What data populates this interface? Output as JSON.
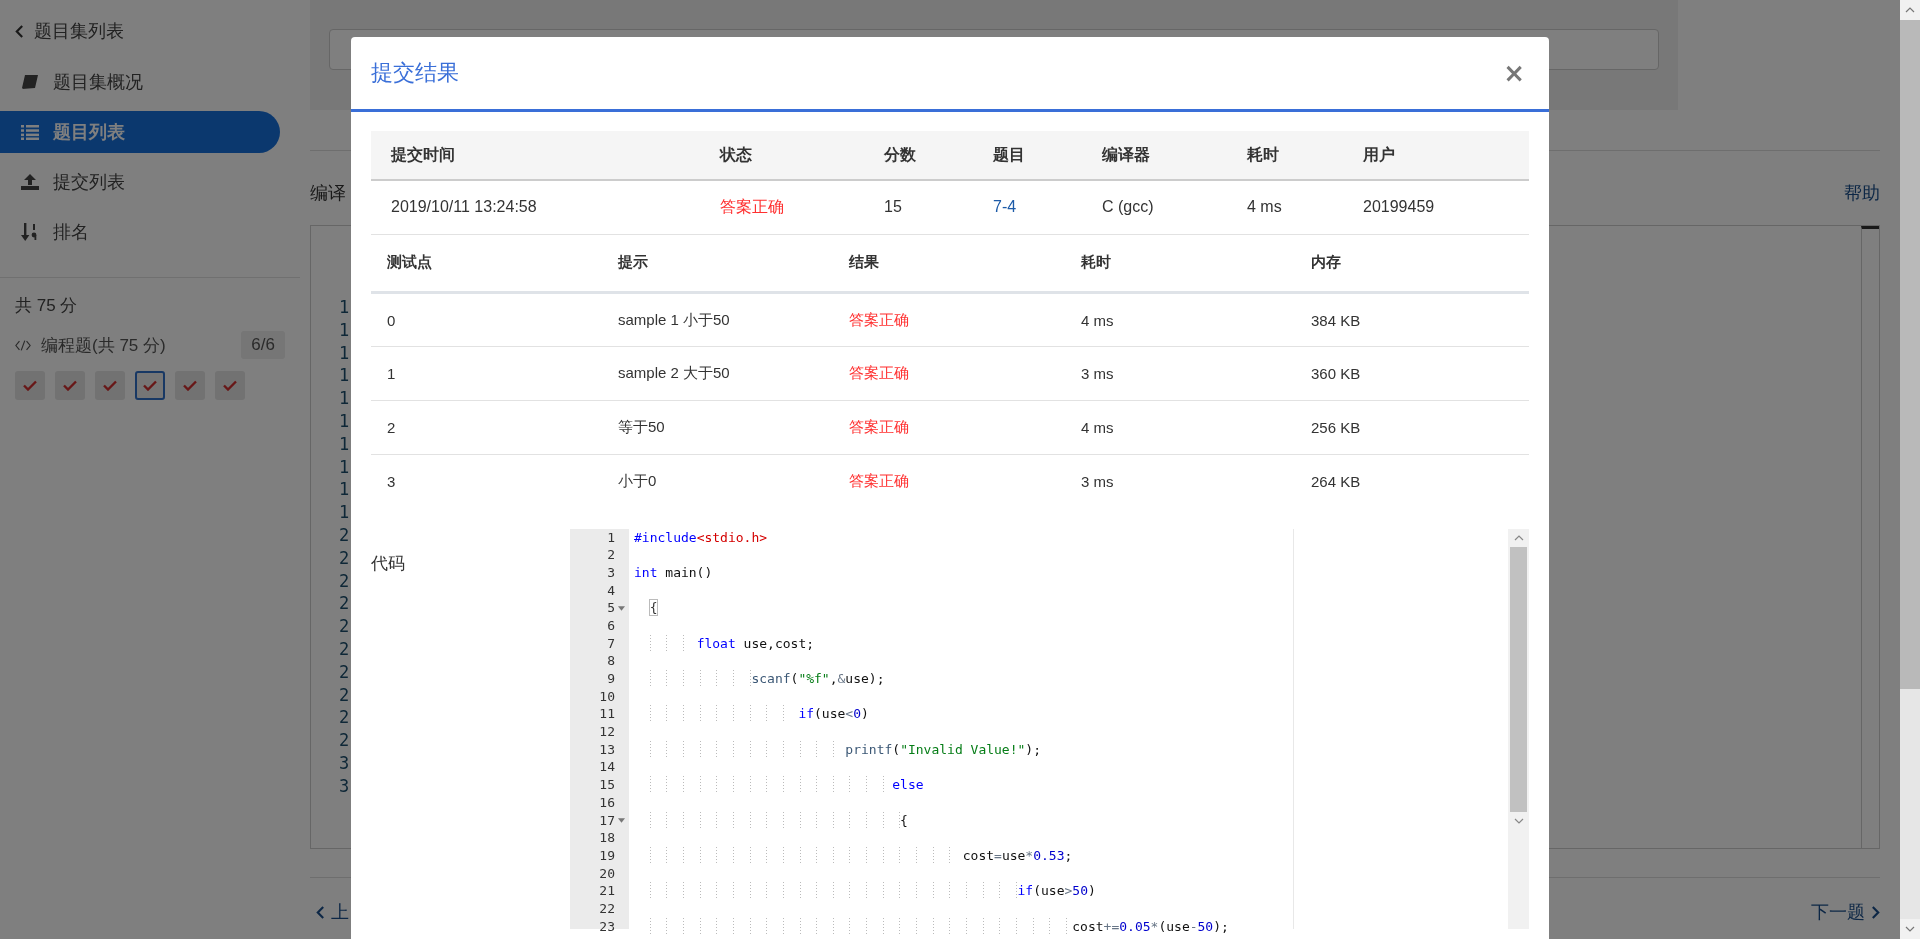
{
  "sidebar": {
    "back": "题目集列表",
    "items": [
      {
        "label": "题目集概况",
        "selected": false
      },
      {
        "label": "题目列表",
        "selected": true
      },
      {
        "label": "提交列表",
        "selected": false
      },
      {
        "label": "排名",
        "selected": false
      }
    ],
    "total": "共 75 分",
    "section": {
      "label": "编程题(共 75 分)",
      "count": "6/6",
      "problems": [
        {
          "selected": false
        },
        {
          "selected": false
        },
        {
          "selected": false
        },
        {
          "selected": true
        },
        {
          "selected": false
        },
        {
          "selected": false
        }
      ]
    }
  },
  "page": {
    "compiler_label": "编译",
    "help": "帮助",
    "line_numbers": [
      "1",
      "1",
      "1",
      "1",
      "1",
      "1",
      "1",
      "1",
      "1",
      "1",
      "2",
      "2",
      "2",
      "2",
      "2",
      "2",
      "2",
      "2",
      "2",
      "2",
      "3",
      "3"
    ],
    "prev": "上",
    "next": "下一题"
  },
  "modal": {
    "title": "提交结果",
    "close": "×",
    "summary": {
      "columns": [
        "提交时间",
        "状态",
        "分数",
        "题目",
        "编译器",
        "耗时",
        "用户"
      ],
      "cells": [
        {
          "kind": "text",
          "text": "2019/10/11 13:24:58"
        },
        {
          "kind": "status",
          "text": "答案正确"
        },
        {
          "kind": "text",
          "text": "15"
        },
        {
          "kind": "link",
          "text": "7-4"
        },
        {
          "kind": "text",
          "text": "C (gcc)"
        },
        {
          "kind": "text",
          "text": "4 ms"
        },
        {
          "kind": "text",
          "text": "20199459"
        }
      ]
    },
    "tests": {
      "columns": [
        "测试点",
        "提示",
        "结果",
        "耗时",
        "内存"
      ],
      "rows": [
        {
          "case": "0",
          "hint": "sample 1 小于50",
          "result": "答案正确",
          "time": "4 ms",
          "memory": "384 KB"
        },
        {
          "case": "1",
          "hint": "sample 2 大于50",
          "result": "答案正确",
          "time": "3 ms",
          "memory": "360 KB"
        },
        {
          "case": "2",
          "hint": "等于50",
          "result": "答案正确",
          "time": "4 ms",
          "memory": "256 KB"
        },
        {
          "case": "3",
          "hint": "小于0",
          "result": "答案正确",
          "time": "3 ms",
          "memory": "264 KB"
        }
      ]
    },
    "code_label": "代码",
    "code": [
      {
        "num": "1",
        "fold": false,
        "tokens": [
          {
            "kind": "kw",
            "text": "#include"
          },
          {
            "kind": "inc",
            "text": "<stdio.h>"
          }
        ]
      },
      {
        "num": "2",
        "fold": false
      },
      {
        "num": "3",
        "fold": false,
        "tokens": [
          {
            "kind": "kw",
            "text": "int"
          },
          {
            "kind": "plain",
            "text": " main()"
          }
        ]
      },
      {
        "num": "4",
        "fold": false
      },
      {
        "num": "5",
        "fold": true,
        "tokens": [
          {
            "kind": "match",
            "text": "  {"
          }
        ]
      },
      {
        "num": "6",
        "fold": false
      },
      {
        "num": "7",
        "fold": false,
        "tokens": [
          {
            "kind": "kw",
            "text": "        float"
          },
          {
            "kind": "plain",
            "text": " use,cost;"
          }
        ]
      },
      {
        "num": "8",
        "fold": false
      },
      {
        "num": "9",
        "fold": false,
        "tokens": [
          {
            "kind": "fn",
            "text": "               scanf"
          },
          {
            "kind": "plain",
            "text": "("
          },
          {
            "kind": "str",
            "text": "\"%f\""
          },
          {
            "kind": "plain",
            "text": ","
          },
          {
            "kind": "op",
            "text": "&"
          },
          {
            "kind": "plain",
            "text": "use);"
          }
        ]
      },
      {
        "num": "10",
        "fold": false
      },
      {
        "num": "11",
        "fold": false,
        "tokens": [
          {
            "kind": "kw",
            "text": "                     if"
          },
          {
            "kind": "plain",
            "text": "(use"
          },
          {
            "kind": "op",
            "text": "<"
          },
          {
            "kind": "num",
            "text": "0"
          },
          {
            "kind": "plain",
            "text": ")"
          }
        ]
      },
      {
        "num": "12",
        "fold": false
      },
      {
        "num": "13",
        "fold": false,
        "tokens": [
          {
            "kind": "fn",
            "text": "                           printf"
          },
          {
            "kind": "plain",
            "text": "("
          },
          {
            "kind": "str",
            "text": "\"Invalid Value!\""
          },
          {
            "kind": "plain",
            "text": ");"
          }
        ]
      },
      {
        "num": "14",
        "fold": false
      },
      {
        "num": "15",
        "fold": false,
        "tokens": [
          {
            "kind": "kw",
            "text": "                                 else"
          }
        ]
      },
      {
        "num": "16",
        "fold": false
      },
      {
        "num": "17",
        "fold": true,
        "tokens": [
          {
            "kind": "plain",
            "text": "                                  {"
          }
        ]
      },
      {
        "num": "18",
        "fold": false
      },
      {
        "num": "19",
        "fold": false,
        "tokens": [
          {
            "kind": "plain",
            "text": "                                          cost"
          },
          {
            "kind": "op",
            "text": "="
          },
          {
            "kind": "plain",
            "text": "use"
          },
          {
            "kind": "op",
            "text": "*"
          },
          {
            "kind": "num",
            "text": "0.53"
          },
          {
            "kind": "plain",
            "text": ";"
          }
        ]
      },
      {
        "num": "20",
        "fold": false
      },
      {
        "num": "21",
        "fold": false,
        "tokens": [
          {
            "kind": "kw",
            "text": "                                                 if"
          },
          {
            "kind": "plain",
            "text": "(use"
          },
          {
            "kind": "op",
            "text": ">"
          },
          {
            "kind": "num",
            "text": "50"
          },
          {
            "kind": "plain",
            "text": ")"
          }
        ]
      },
      {
        "num": "22",
        "fold": false
      },
      {
        "num": "23",
        "fold": false,
        "tokens": [
          {
            "kind": "plain",
            "text": "                                                        cost"
          },
          {
            "kind": "op",
            "text": "+="
          },
          {
            "kind": "num",
            "text": "0.05"
          },
          {
            "kind": "op",
            "text": "*"
          },
          {
            "kind": "plain",
            "text": "(use"
          },
          {
            "kind": "op",
            "text": "-"
          },
          {
            "kind": "num",
            "text": "50"
          },
          {
            "kind": "plain",
            "text": ");"
          }
        ]
      }
    ]
  }
}
